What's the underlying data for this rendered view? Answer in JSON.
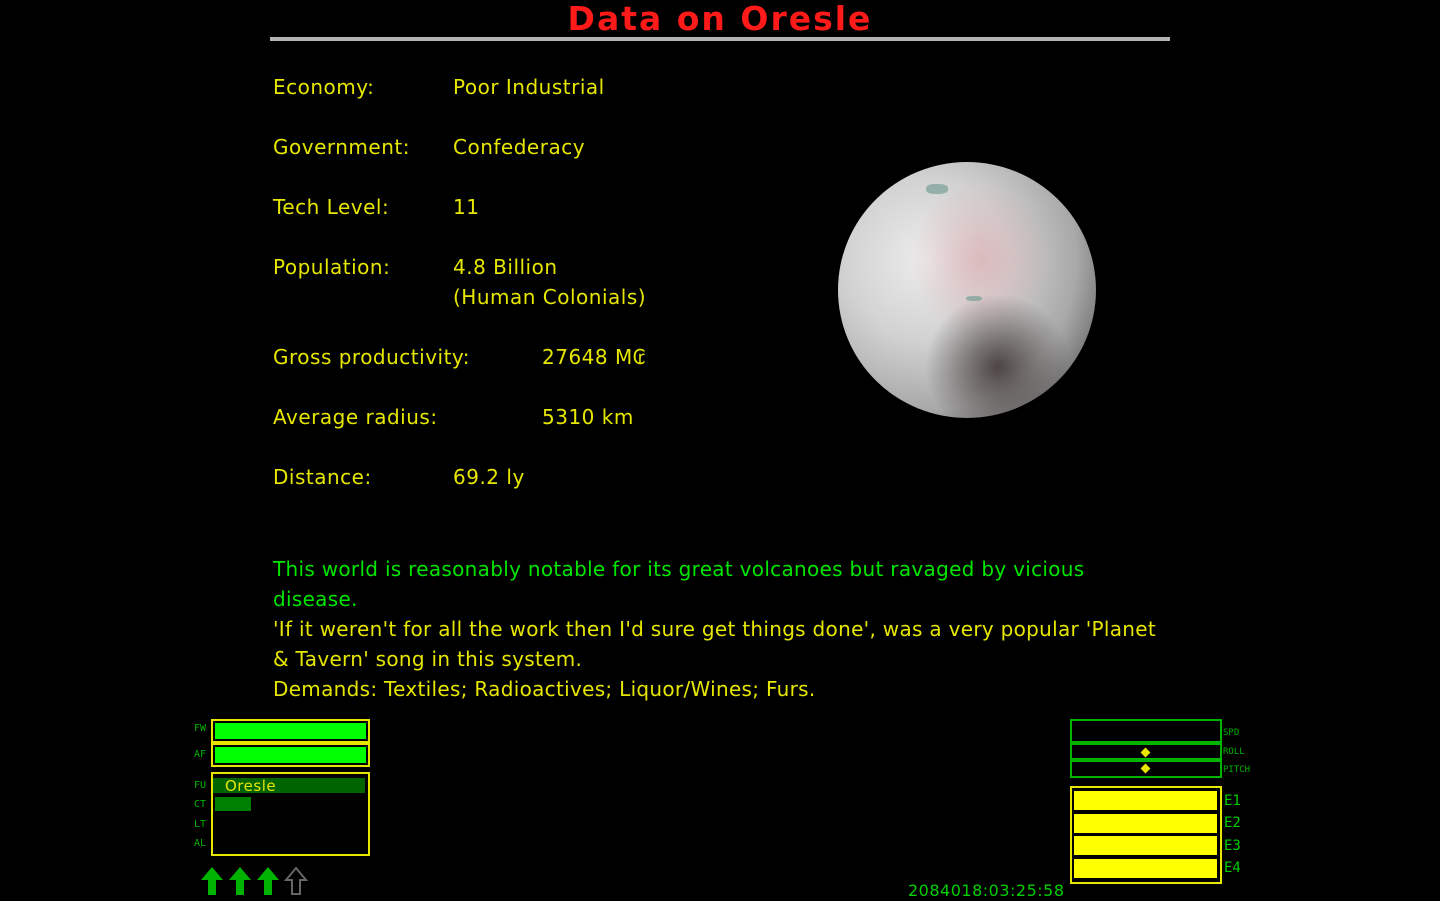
{
  "screen": {
    "title": "Data on Oresle"
  },
  "info": {
    "economy_label": "Economy:",
    "economy_value": "Poor Industrial",
    "government_label": "Government:",
    "government_value": "Confederacy",
    "tech_label": "Tech Level:",
    "tech_value": "11",
    "population_label": "Population:",
    "population_value": "4.8 Billion",
    "population_species": "(Human Colonials)",
    "productivity_label": "Gross productivity:",
    "productivity_value": "27648 M₢",
    "radius_label": "Average radius:",
    "radius_value": "5310 km",
    "distance_label": "Distance:",
    "distance_value": "69.2 ly"
  },
  "description": {
    "line1": "This world is reasonably notable for its great volcanoes but ravaged by vicious disease.",
    "line2": "'If it weren't for all the work then I'd sure get things done', was a very popular 'Planet & Tavern' song in this system.",
    "demands": "Demands: Textiles; Radioactives; Liquor/Wines; Furs."
  },
  "hud_left": {
    "fw_label": "FW",
    "af_label": "AF",
    "fu_label": "FU",
    "ct_label": "CT",
    "lt_label": "LT",
    "al_label": "AL",
    "fw_level": 1.0,
    "af_level": 1.0,
    "scanner_target": "Oresle",
    "missiles_ready": 3,
    "missile_slots": 4
  },
  "hud_right": {
    "spd_label": "SPD",
    "roll_label": "ROLL",
    "pitch_label": "PITCH",
    "e1_label": "E1",
    "e2_label": "E2",
    "e3_label": "E3",
    "e4_label": "E4",
    "energy_levels": [
      1,
      1,
      1,
      1
    ]
  },
  "clock": {
    "value": "2084018:03:25:58"
  },
  "colors": {
    "title": "#ff1a1a",
    "label": "#e6e600",
    "description": "#00e600",
    "hud_green": "#00ff00",
    "hud_frame": "#e6e600"
  }
}
